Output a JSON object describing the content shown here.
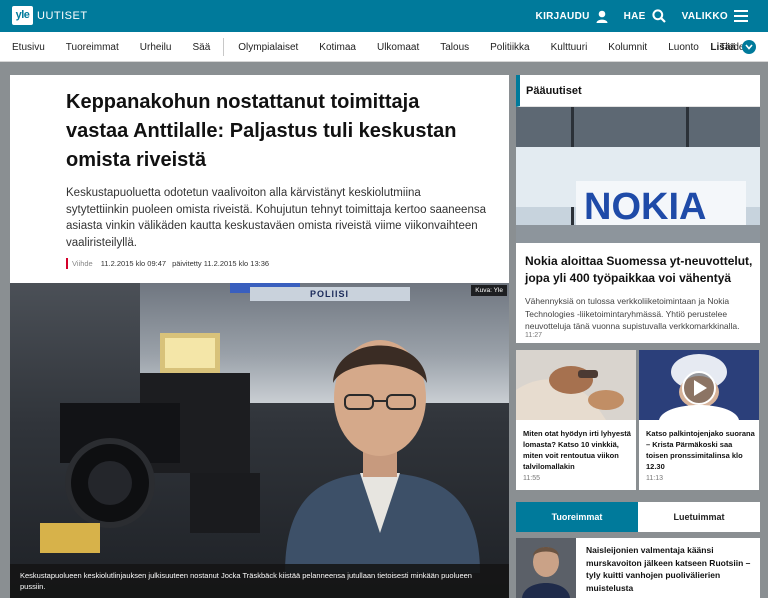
{
  "site": {
    "logo_badge": "yle",
    "logo_text": "UUTISET",
    "actions": {
      "login": "KIRJAUDU",
      "search": "HAE",
      "menu": "VALIKKO"
    }
  },
  "nav": {
    "items": [
      "Etusivu",
      "Tuoreimmat",
      "Urheilu",
      "Sää"
    ],
    "items2": [
      "Olympialaiset",
      "Kotimaa",
      "Ulkomaat",
      "Talous",
      "Politiikka",
      "Kulttuuri",
      "Kolumnit",
      "Luonto",
      "Tiede"
    ],
    "more": "Lisää"
  },
  "article": {
    "headline": "Keppanakohun nostattanut toimittaja vastaa Anttilalle: Paljastus tuli keskustan omista riveistä",
    "lead": "Keskustapuoluetta odotetun vaalivoiton alla kärvistänyt keskiolutmiina sytytettiinkin puoleen omista riveistä. Kohujutun tehnyt toimittaja kertoo saaneensa asiasta vinkin välikäden kautta keskustaväen omista riveistä viime viikonvaihteen vaaliristeilyllä.",
    "category": "Viihde",
    "published": "11.2.2015 klo 09:47",
    "updated": "päivitetty 11.2.2015 klo 13:36",
    "image_credit": "Kuva: Yle",
    "car_text": "POLIISI",
    "image_caption": "Keskustapuolueen keskiolutlinjauksen julkisuuteen nostanut Jocka Träskbäck kiistää pelanneensa jutullaan tietoisesti minkään puolueen pussiin."
  },
  "aside": {
    "header": "Pääuutiset",
    "nokia_sign": "NOKIA",
    "top_story": {
      "title": "Nokia aloittaa Suomessa yt-neuvottelut, jopa yli 400 työpaikkaa voi vähentyä",
      "lead": "Vähennyksiä on tulossa verkkoliiketoimintaan ja Nokia Technologies -liiketoimintaryhmässä. Yhtiö perustelee neuvotteluja tänä vuonna supistuvalla verkkomarkkinalla.",
      "time": "11:27"
    },
    "small_stories": [
      {
        "title": "Miten otat hyödyn irti lyhyestä lomasta? Katso 10 vinkkiä, miten voit rentoutua viikon talvilomallakin",
        "time": "11:55"
      },
      {
        "title": "Katso palkintojenjako suorana – Krista Pärmäkoski saa toisen pronssimitalinsa klo 12.30",
        "time": "11:13"
      }
    ],
    "tabs": {
      "active": "Tuoreimmat",
      "inactive": "Luetuimmat"
    },
    "latest": {
      "title": "Naisleijonien valmentaja käänsi murskavoiton jälkeen katseen Ruotsiin – tyly kuitti vanhojen puolivälierien muistelusta"
    }
  },
  "colors": {
    "brand": "#007a9b",
    "accent_red": "#d4002a"
  }
}
